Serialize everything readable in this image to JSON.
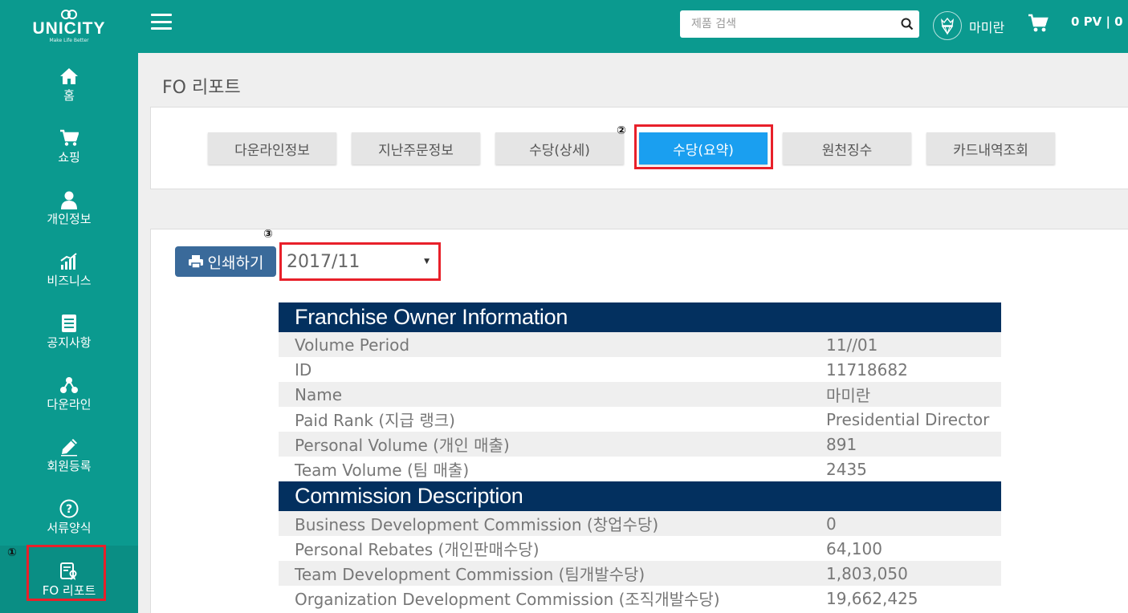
{
  "brand": {
    "name": "UNICITY",
    "tagline": "Make Life Better"
  },
  "sidebar": {
    "items": [
      {
        "label": "홈",
        "icon": "home-icon"
      },
      {
        "label": "쇼핑",
        "icon": "cart-icon"
      },
      {
        "label": "개인정보",
        "icon": "person-icon"
      },
      {
        "label": "비즈니스",
        "icon": "bar-chart-icon"
      },
      {
        "label": "공지사항",
        "icon": "document-icon"
      },
      {
        "label": "다운라인",
        "icon": "share-icon"
      },
      {
        "label": "회원등록",
        "icon": "pencil-icon"
      },
      {
        "label": "서류양식",
        "icon": "question-icon"
      },
      {
        "label": "FO 리포트",
        "icon": "report-icon",
        "active": true
      }
    ]
  },
  "header": {
    "search_placeholder": "제품 검색",
    "username": "마미란",
    "pv": "0 PV  |  0"
  },
  "page": {
    "title": "FO 리포트"
  },
  "tabs": [
    {
      "label": "다운라인정보"
    },
    {
      "label": "지난주문정보"
    },
    {
      "label": "수당(상세)"
    },
    {
      "label": "수당(요약)",
      "active": true
    },
    {
      "label": "원천징수"
    },
    {
      "label": "카드내역조회"
    }
  ],
  "markers": {
    "m1": "①",
    "m2": "②",
    "m3": "③"
  },
  "report": {
    "print_label": "인쇄하기",
    "period": "2017/11",
    "sections": [
      {
        "title": "Franchise Owner Information",
        "rows": [
          {
            "key": "Volume Period",
            "value": "11//01"
          },
          {
            "key": "ID",
            "value": "11718682"
          },
          {
            "key": "Name",
            "value": "마미란"
          },
          {
            "key": "Paid Rank (지급 랭크)",
            "value": "Presidential Director"
          },
          {
            "key": "Personal Volume (개인 매출)",
            "value": "891"
          },
          {
            "key": "Team Volume (팀 매출)",
            "value": "2435"
          }
        ]
      },
      {
        "title": "Commission Description",
        "rows": [
          {
            "key": "Business Development Commission (창업수당)",
            "value": "0"
          },
          {
            "key": "Personal Rebates (개인판매수당)",
            "value": "64,100"
          },
          {
            "key": "Team Development Commission (팀개발수당)",
            "value": "1,803,050"
          },
          {
            "key": "Organization Development Commission (조직개발수당)",
            "value": "19,662,425"
          }
        ]
      }
    ]
  },
  "colors": {
    "primary": "#0b9a8f",
    "tab_active": "#1a9ff0",
    "section_header": "#03305f",
    "highlight": "#e8202a",
    "print_button": "#3a6a9a"
  }
}
